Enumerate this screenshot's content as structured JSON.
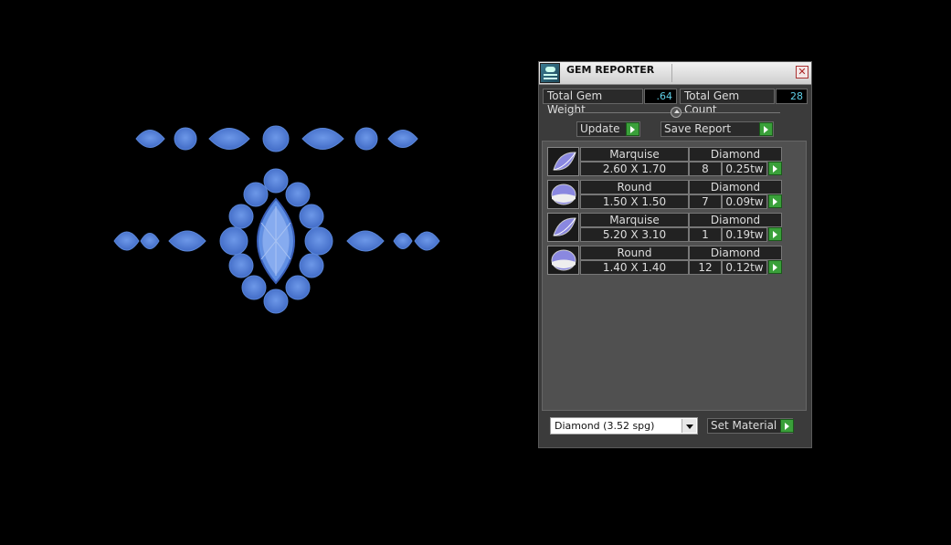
{
  "window": {
    "title": "GEM REPORTER",
    "close_icon": "close-icon"
  },
  "summary": {
    "weight_label": "Total Gem Weight",
    "weight_value": ".64",
    "count_label": "Total Gem Count",
    "count_value": "28"
  },
  "actions": {
    "update_label": "Update",
    "save_label": "Save Report"
  },
  "gems": [
    {
      "shape": "Marquise",
      "material": "Diamond",
      "size": "2.60 X 1.70",
      "count": "8",
      "weight": "0.25tw"
    },
    {
      "shape": "Round",
      "material": "Diamond",
      "size": "1.50 X 1.50",
      "count": "7",
      "weight": "0.09tw"
    },
    {
      "shape": "Marquise",
      "material": "Diamond",
      "size": "5.20 X 3.10",
      "count": "1",
      "weight": "0.19tw"
    },
    {
      "shape": "Round",
      "material": "Diamond",
      "size": "1.40 X 1.40",
      "count": "12",
      "weight": "0.12tw"
    }
  ],
  "material": {
    "selected": "Diamond     (3.52 spg)",
    "set_label": "Set Material"
  },
  "colors": {
    "gem_fill": "#4f7fd8",
    "go_button": "#3aa03a",
    "value_text": "#5fd0e8"
  }
}
